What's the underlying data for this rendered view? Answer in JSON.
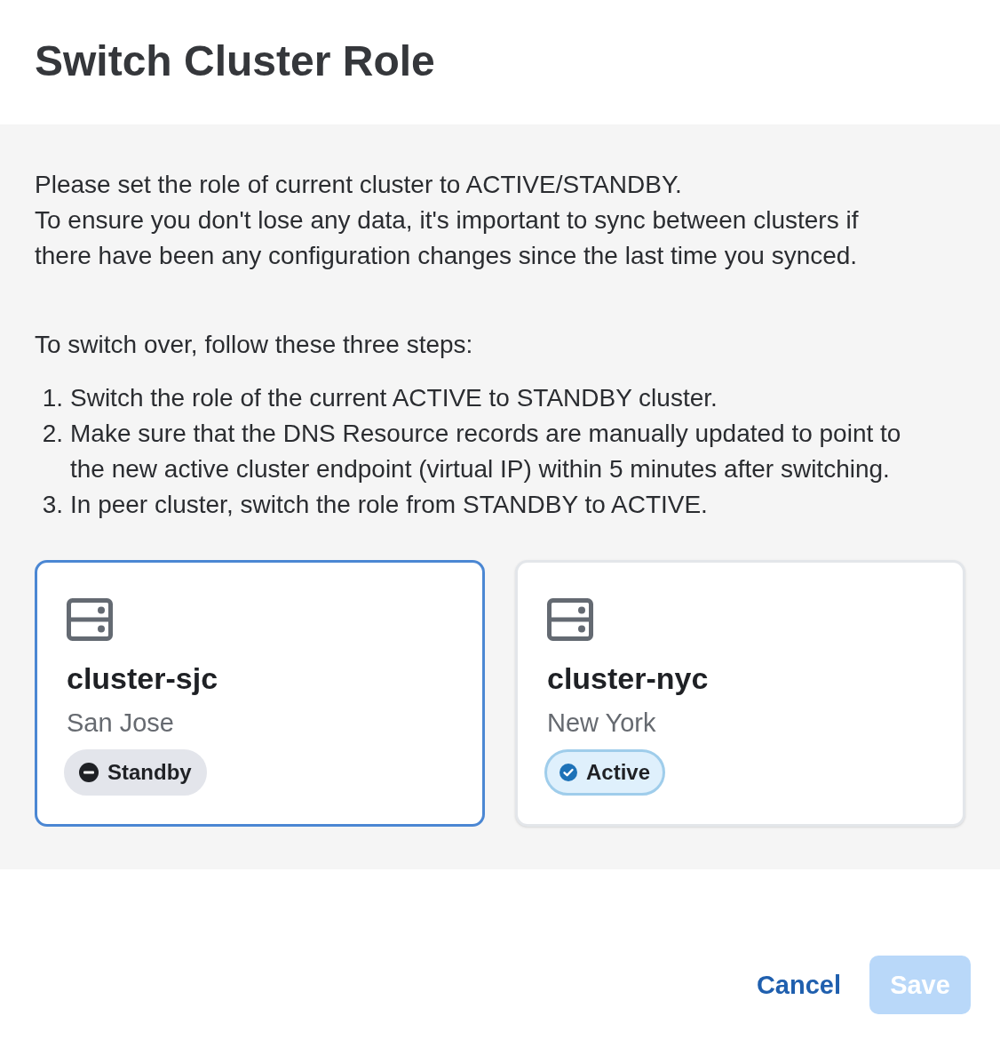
{
  "dialog": {
    "title": "Switch Cluster Role"
  },
  "intro": [
    "Please set the role of current cluster to ACTIVE/STANDBY.",
    "To ensure you don't lose any data, it's important to sync between clusters if there have been any configuration changes since the last time you synced."
  ],
  "steps_heading": "To switch over, follow these three steps:",
  "steps": [
    {
      "number": "1.",
      "text": "Switch the role of the current ACTIVE to STANDBY cluster."
    },
    {
      "number": "2.",
      "text": "Make sure that the DNS Resource records are manually updated to point to the new active cluster endpoint (virtual IP) within 5 minutes after switching."
    },
    {
      "number": "3.",
      "text": "In peer cluster, switch the role from STANDBY to ACTIVE."
    }
  ],
  "clusters": [
    {
      "name": "cluster-sjc",
      "location": "San Jose",
      "selected": true,
      "status": {
        "kind": "standby",
        "label": "Standby"
      }
    },
    {
      "name": "cluster-nyc",
      "location": "New York",
      "selected": false,
      "status": {
        "kind": "active",
        "label": "Active"
      }
    }
  ],
  "buttons": [
    {
      "kind": "link",
      "label": "Cancel",
      "disabled": false
    },
    {
      "kind": "primary",
      "label": "Save",
      "disabled": true
    }
  ]
}
